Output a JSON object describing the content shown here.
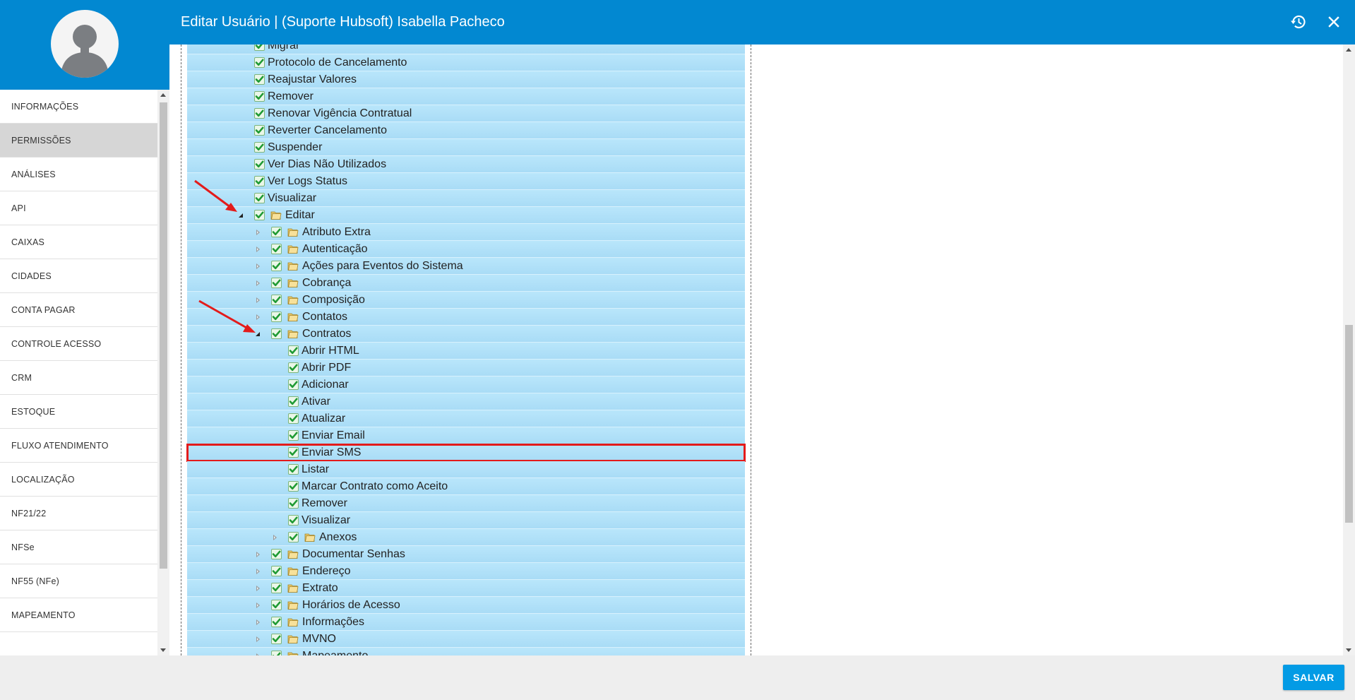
{
  "header": {
    "title": "Editar Usuário | (Suporte Hubsoft) Isabella Pacheco",
    "history_icon": "history-icon",
    "close_icon": "close-icon",
    "background": "#0288d1"
  },
  "sidebar": {
    "avatar_icon": "user-avatar-icon",
    "items": [
      {
        "label": "INFORMAÇÕES",
        "active": false
      },
      {
        "label": "PERMISSÕES",
        "active": true
      },
      {
        "label": "ANÁLISES",
        "active": false
      },
      {
        "label": "API",
        "active": false
      },
      {
        "label": "CAIXAS",
        "active": false
      },
      {
        "label": "CIDADES",
        "active": false
      },
      {
        "label": "CONTA PAGAR",
        "active": false
      },
      {
        "label": "CONTROLE ACESSO",
        "active": false
      },
      {
        "label": "CRM",
        "active": false
      },
      {
        "label": "ESTOQUE",
        "active": false
      },
      {
        "label": "FLUXO ATENDIMENTO",
        "active": false
      },
      {
        "label": "LOCALIZAÇÃO",
        "active": false
      },
      {
        "label": "NF21/22",
        "active": false
      },
      {
        "label": "NFSe",
        "active": false
      },
      {
        "label": "NF55 (NFe)",
        "active": false
      },
      {
        "label": "MAPEAMENTO",
        "active": false
      }
    ]
  },
  "tree": {
    "rows": [
      {
        "label": "Migrar",
        "level": 0,
        "folder": false,
        "expander": "none",
        "checked": true
      },
      {
        "label": "Protocolo de Cancelamento",
        "level": 0,
        "folder": false,
        "expander": "none",
        "checked": true
      },
      {
        "label": "Reajustar Valores",
        "level": 0,
        "folder": false,
        "expander": "none",
        "checked": true
      },
      {
        "label": "Remover",
        "level": 0,
        "folder": false,
        "expander": "none",
        "checked": true
      },
      {
        "label": "Renovar Vigência Contratual",
        "level": 0,
        "folder": false,
        "expander": "none",
        "checked": true
      },
      {
        "label": "Reverter Cancelamento",
        "level": 0,
        "folder": false,
        "expander": "none",
        "checked": true
      },
      {
        "label": "Suspender",
        "level": 0,
        "folder": false,
        "expander": "none",
        "checked": true
      },
      {
        "label": "Ver Dias Não Utilizados",
        "level": 0,
        "folder": false,
        "expander": "none",
        "checked": true
      },
      {
        "label": "Ver Logs Status",
        "level": 0,
        "folder": false,
        "expander": "none",
        "checked": true
      },
      {
        "label": "Visualizar",
        "level": 0,
        "folder": false,
        "expander": "none",
        "checked": true
      },
      {
        "label": "Editar",
        "level": 0,
        "folder": true,
        "expander": "expanded",
        "checked": true
      },
      {
        "label": "Atributo Extra",
        "level": 1,
        "folder": true,
        "expander": "collapsed",
        "checked": true
      },
      {
        "label": "Autenticação",
        "level": 1,
        "folder": true,
        "expander": "collapsed",
        "checked": true
      },
      {
        "label": "Ações para Eventos do Sistema",
        "level": 1,
        "folder": true,
        "expander": "collapsed",
        "checked": true
      },
      {
        "label": "Cobrança",
        "level": 1,
        "folder": true,
        "expander": "collapsed",
        "checked": true
      },
      {
        "label": "Composição",
        "level": 1,
        "folder": true,
        "expander": "collapsed",
        "checked": true
      },
      {
        "label": "Contatos",
        "level": 1,
        "folder": true,
        "expander": "collapsed",
        "checked": true
      },
      {
        "label": "Contratos",
        "level": 1,
        "folder": true,
        "expander": "expanded",
        "checked": true
      },
      {
        "label": "Abrir HTML",
        "level": 2,
        "folder": false,
        "expander": "none",
        "checked": true
      },
      {
        "label": "Abrir PDF",
        "level": 2,
        "folder": false,
        "expander": "none",
        "checked": true
      },
      {
        "label": "Adicionar",
        "level": 2,
        "folder": false,
        "expander": "none",
        "checked": true
      },
      {
        "label": "Ativar",
        "level": 2,
        "folder": false,
        "expander": "none",
        "checked": true
      },
      {
        "label": "Atualizar",
        "level": 2,
        "folder": false,
        "expander": "none",
        "checked": true
      },
      {
        "label": "Enviar Email",
        "level": 2,
        "folder": false,
        "expander": "none",
        "checked": true
      },
      {
        "label": "Enviar SMS",
        "level": 2,
        "folder": false,
        "expander": "none",
        "checked": true,
        "highlight": true
      },
      {
        "label": "Listar",
        "level": 2,
        "folder": false,
        "expander": "none",
        "checked": true
      },
      {
        "label": "Marcar Contrato como Aceito",
        "level": 2,
        "folder": false,
        "expander": "none",
        "checked": true
      },
      {
        "label": "Remover",
        "level": 2,
        "folder": false,
        "expander": "none",
        "checked": true
      },
      {
        "label": "Visualizar",
        "level": 2,
        "folder": false,
        "expander": "none",
        "checked": true
      },
      {
        "label": "Anexos",
        "level": 2,
        "folder": true,
        "expander": "collapsed",
        "checked": true
      },
      {
        "label": "Documentar Senhas",
        "level": 1,
        "folder": true,
        "expander": "collapsed",
        "checked": true
      },
      {
        "label": "Endereço",
        "level": 1,
        "folder": true,
        "expander": "collapsed",
        "checked": true
      },
      {
        "label": "Extrato",
        "level": 1,
        "folder": true,
        "expander": "collapsed",
        "checked": true
      },
      {
        "label": "Horários de Acesso",
        "level": 1,
        "folder": true,
        "expander": "collapsed",
        "checked": true
      },
      {
        "label": "Informações",
        "level": 1,
        "folder": true,
        "expander": "collapsed",
        "checked": true
      },
      {
        "label": "MVNO",
        "level": 1,
        "folder": true,
        "expander": "collapsed",
        "checked": true
      },
      {
        "label": "Mapeamento",
        "level": 1,
        "folder": true,
        "expander": "collapsed",
        "checked": true
      }
    ]
  },
  "footer": {
    "save_label": "SALVAR"
  },
  "colors": {
    "accent": "#0288d1",
    "button": "#039be5",
    "row_bg": "#b3e1f9",
    "check": "#27a33a",
    "highlight": "#e31b1b"
  }
}
